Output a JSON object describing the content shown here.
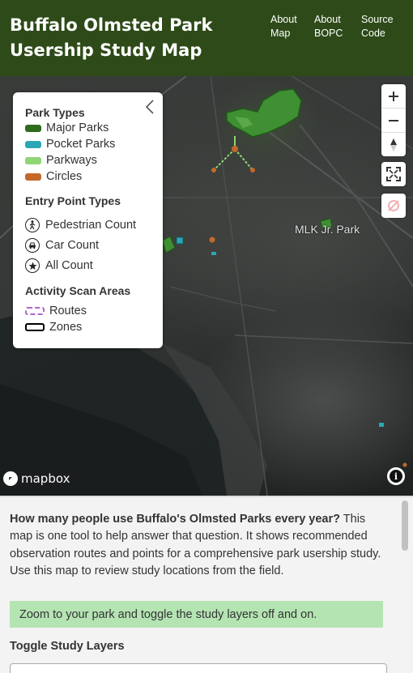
{
  "header": {
    "title": "Buffalo Olmsted Park Usership Study Map",
    "nav": [
      {
        "label": "About Map"
      },
      {
        "label": "About BOPC"
      },
      {
        "label": "Source Code"
      }
    ]
  },
  "legend": {
    "park_types": {
      "heading": "Park Types",
      "items": [
        {
          "label": "Major Parks",
          "color": "#2f6b1d"
        },
        {
          "label": "Pocket Parks",
          "color": "#2aa7b5"
        },
        {
          "label": "Parkways",
          "color": "#8fd675"
        },
        {
          "label": "Circles",
          "color": "#c4692a"
        }
      ]
    },
    "entry_points": {
      "heading": "Entry Point Types",
      "items": [
        {
          "label": "Pedestrian Count",
          "icon": "pedestrian-icon"
        },
        {
          "label": "Car Count",
          "icon": "car-icon"
        },
        {
          "label": "All Count",
          "icon": "star-icon"
        }
      ]
    },
    "activity": {
      "heading": "Activity Scan Areas",
      "items": [
        {
          "label": "Routes",
          "color": "#b466c9"
        },
        {
          "label": "Zones",
          "color": "#000000"
        }
      ]
    }
  },
  "map": {
    "place_label": "MLK Jr. Park",
    "attribution": "mapbox"
  },
  "panel": {
    "intro_bold": "How many people use Buffalo's Olmsted Parks every year?",
    "intro_rest": " This map is one tool to help answer that question. It shows recommended observation routes and points for a comprehensive park usership study. Use this map to review study locations from the field.",
    "tip": "Zoom to your park and toggle the study layers off and on.",
    "toggle_heading": "Toggle Study Layers"
  }
}
